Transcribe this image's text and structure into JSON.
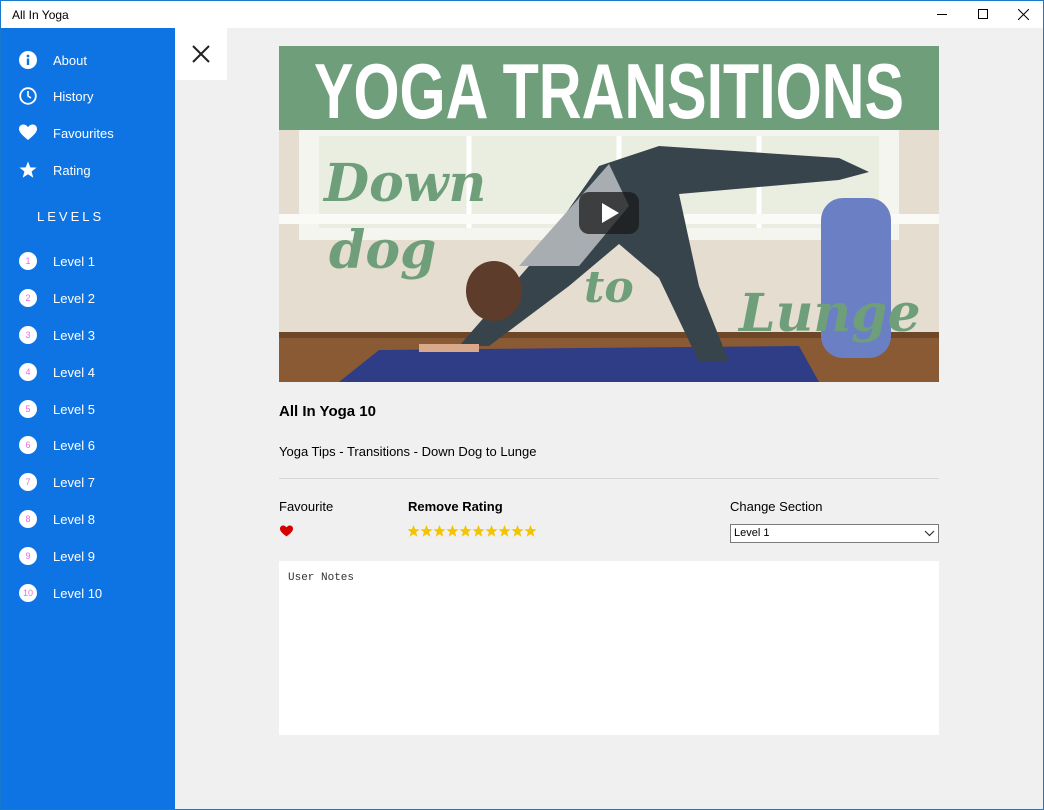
{
  "window": {
    "title": "All In Yoga"
  },
  "sidebar": {
    "items": [
      {
        "label": "About",
        "icon": "info-icon"
      },
      {
        "label": "History",
        "icon": "clock-icon"
      },
      {
        "label": "Favourites",
        "icon": "heart-icon"
      },
      {
        "label": "Rating",
        "icon": "star-icon"
      }
    ],
    "levels_heading": "LEVELS",
    "levels": [
      {
        "num": "1",
        "label": "Level 1"
      },
      {
        "num": "2",
        "label": "Level 2"
      },
      {
        "num": "3",
        "label": "Level 3"
      },
      {
        "num": "4",
        "label": "Level 4"
      },
      {
        "num": "5",
        "label": "Level 5"
      },
      {
        "num": "6",
        "label": "Level 6"
      },
      {
        "num": "7",
        "label": "Level 7"
      },
      {
        "num": "8",
        "label": "Level 8"
      },
      {
        "num": "9",
        "label": "Level 9"
      },
      {
        "num": "10",
        "label": "Level 10"
      }
    ]
  },
  "video": {
    "banner": "YOGA TRANSITIONS",
    "overlay_words": [
      "Down",
      "dog",
      "to",
      "Lunge"
    ]
  },
  "detail": {
    "title": "All In Yoga 10",
    "description": "Yoga Tips - Transitions - Down Dog to Lunge",
    "favourite_label": "Favourite",
    "rating_label": "Remove Rating",
    "rating_stars": 10,
    "section_label": "Change Section",
    "section_value": "Level 1",
    "notes_placeholder": "User Notes"
  },
  "colors": {
    "sidebar": "#0e74e4",
    "heart": "#d40000",
    "star": "#f5c400",
    "banner": "#6f9e7a",
    "level_number": "#ea6bdc"
  }
}
